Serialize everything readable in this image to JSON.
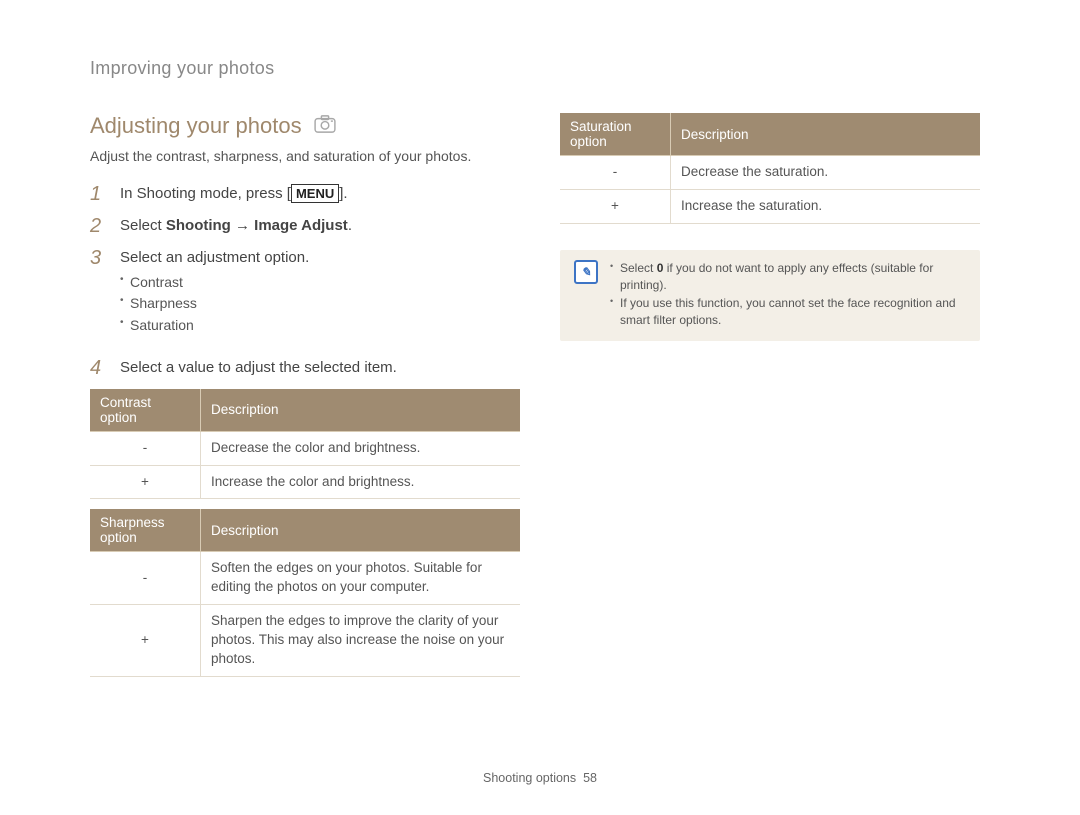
{
  "section_header": "Improving your photos",
  "main_title": "Adjusting your photos",
  "intro": "Adjust the contrast, sharpness, and saturation of your photos.",
  "steps": [
    {
      "num": "1",
      "prefix": "In Shooting mode, press [",
      "menu_label": "MENU",
      "suffix": "]."
    },
    {
      "num": "2",
      "prefix": "Select ",
      "bold": "Shooting → Image Adjust",
      "suffix": "."
    },
    {
      "num": "3",
      "text": "Select an adjustment option.",
      "bullets": [
        "Contrast",
        "Sharpness",
        "Saturation"
      ]
    },
    {
      "num": "4",
      "text": "Select a value to adjust the selected item."
    }
  ],
  "contrast_table": {
    "headers": [
      "Contrast option",
      "Description"
    ],
    "rows": [
      {
        "key": "-",
        "desc": "Decrease the color and brightness."
      },
      {
        "key": "+",
        "desc": "Increase the color and brightness."
      }
    ]
  },
  "sharpness_table": {
    "headers": [
      "Sharpness option",
      "Description"
    ],
    "rows": [
      {
        "key": "-",
        "desc": "Soften the edges on your photos. Suitable for editing the photos on your computer."
      },
      {
        "key": "+",
        "desc": "Sharpen the edges to improve the clarity of your photos. This may also increase the noise on your photos."
      }
    ]
  },
  "saturation_table": {
    "headers": [
      "Saturation option",
      "Description"
    ],
    "rows": [
      {
        "key": "-",
        "desc": "Decrease the saturation."
      },
      {
        "key": "+",
        "desc": "Increase the saturation."
      }
    ]
  },
  "notes": [
    {
      "prefix": "Select ",
      "bold": "0",
      "suffix": " if you do not want to apply any effects (suitable for printing)."
    },
    {
      "text": "If you use this function, you cannot set the face recognition and smart filter options."
    }
  ],
  "footer": {
    "label": "Shooting options",
    "page": "58"
  }
}
